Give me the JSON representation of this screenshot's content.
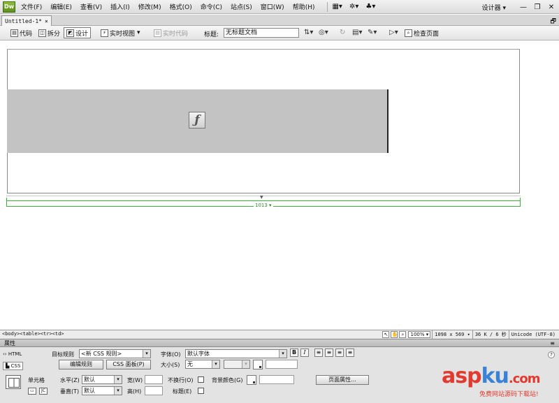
{
  "app": {
    "logo": "Dw"
  },
  "menu": {
    "items": [
      "文件(F)",
      "编辑(E)",
      "查看(V)",
      "插入(I)",
      "修改(M)",
      "格式(O)",
      "命令(C)",
      "站点(S)",
      "窗口(W)",
      "帮助(H)"
    ],
    "icons": [
      "layout-icon",
      "gear-icon",
      "site-icon"
    ],
    "workspace": "设计器",
    "window_buttons": [
      "—",
      "❐",
      "✕"
    ]
  },
  "tab": {
    "name": "Untitled-1*",
    "close": "×",
    "restore": "🗗"
  },
  "toolbar": {
    "code": "代码",
    "split": "拆分",
    "design": "设计",
    "live_view": "实时视图",
    "live_code": "实时代码",
    "title_label": "标题:",
    "title_value": "无标题文档",
    "inspect": "检查页面"
  },
  "canvas": {
    "table_width": "1013"
  },
  "status": {
    "tag_selector": "<body><table><tr><td>",
    "zoom": "100%",
    "dimensions": "1098 x 569",
    "size": "36 K / 6 秒",
    "encoding": "Unicode (UTF-8)"
  },
  "properties": {
    "header": "属性",
    "html_tab": "HTML",
    "css_tab": "CSS",
    "target_rule_label": "目标规则",
    "target_rule_value": "<新 CSS 规则>",
    "edit_rule": "编辑规则",
    "css_panel": "CSS 面板(P)",
    "font_label": "字体(O)",
    "font_value": "默认字体",
    "size_label": "大小(S)",
    "size_value": "无",
    "bold": "B",
    "italic": "I",
    "cell_label": "单元格",
    "horz_label": "水平(Z)",
    "horz_value": "默认",
    "vert_label": "垂直(T)",
    "vert_value": "默认",
    "width_label": "宽(W)",
    "height_label": "高(H)",
    "nowrap_label": "不换行(O)",
    "header_label": "标题(E)",
    "bg_label": "背景颜色(G)",
    "page_props": "页面属性..."
  },
  "watermark": {
    "brand_a": "asp",
    "brand_b": "ku",
    "brand_c": ".com",
    "slogan": "免费网站源码下载站!"
  }
}
